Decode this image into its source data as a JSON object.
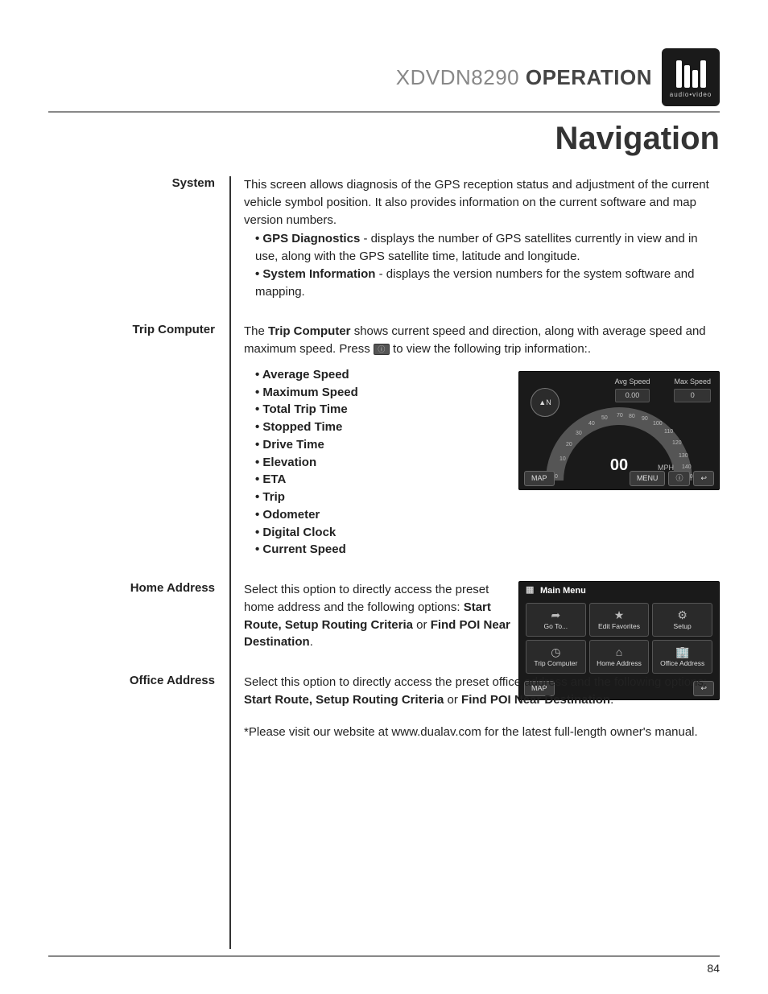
{
  "header": {
    "model": "XDVDN8290",
    "operation": "OPERATION",
    "logo_sub": "audio•video"
  },
  "section_title": "Navigation",
  "rows": {
    "system": {
      "label": "System",
      "intro": "This screen allows diagnosis of the GPS reception status and adjustment of the current vehicle symbol position. It also provides information on the current software and map version numbers.",
      "b1_label": "GPS Diagnostics",
      "b1_text": " - displays the number of GPS satellites currently in view and in use, along with the GPS satellite time, latitude and longitude.",
      "b2_label": "System Information",
      "b2_text": " - displays the version numbers for the system software and mapping."
    },
    "trip": {
      "label": "Trip Computer",
      "pre": "The ",
      "bold1": "Trip Computer",
      "mid": " shows current speed and direction, along with average speed and maximum speed. Press ",
      "post": " to view the following trip information:.",
      "items": [
        "Average Speed",
        "Maximum Speed",
        "Total Trip Time",
        "Stopped Time",
        "Drive Time",
        "Elevation",
        "ETA",
        "Trip",
        "Odometer",
        "Digital Clock",
        "Current Speed"
      ]
    },
    "home": {
      "label": "Home Address",
      "pre": "Select this option to directly access the preset home address and the following options: ",
      "opts": "Start Route, Setup Routing Criteria",
      "or": " or ",
      "opt2": "Find POI Near Destination",
      "end": "."
    },
    "office": {
      "label": "Office Address",
      "pre": "Select this option to directly access the preset office address and the following options: ",
      "opts": "Start Route, Setup Routing Criteria",
      "or": " or ",
      "opt2": "Find POI Near Destination",
      "end": ".",
      "footnote": "*Please visit our website at www.dualav.com for the latest full-length owner's manual."
    }
  },
  "speedo": {
    "avg_label": "Avg Speed",
    "avg_val": "0.00",
    "max_label": "Max Speed",
    "max_val": "0",
    "center": "00",
    "unit": "MPH",
    "btn_map": "MAP",
    "btn_menu": "MENU"
  },
  "mainmenu": {
    "title": "Main Menu",
    "items": [
      "Go To...",
      "Edit Favorites",
      "Setup",
      "Trip Computer",
      "Home Address",
      "Office Address"
    ],
    "icons": [
      "➦",
      "★",
      "⚙",
      "◷",
      "⌂",
      "🏢"
    ],
    "btn_map": "MAP"
  },
  "page_number": "84"
}
